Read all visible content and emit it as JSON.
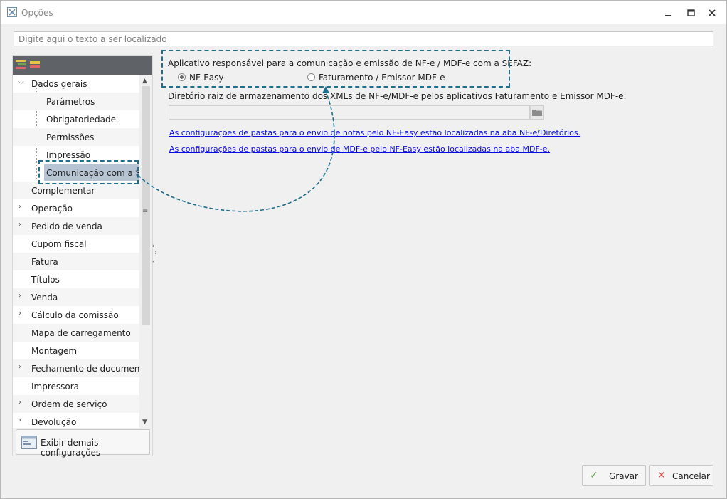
{
  "window": {
    "title": "Opções"
  },
  "search": {
    "placeholder": "Digite aqui o texto a ser localizado",
    "value": ""
  },
  "tree": {
    "items": [
      {
        "label": "Dados gerais",
        "level": 1,
        "expanded": true
      },
      {
        "label": "Parâmetros",
        "level": 2
      },
      {
        "label": "Obrigatoriedade",
        "level": 2
      },
      {
        "label": "Permissões",
        "level": 2
      },
      {
        "label": "Impressão",
        "level": 2
      },
      {
        "label": "Comunicação com a SEF",
        "level": 2,
        "selected": true
      },
      {
        "label": "Complementar",
        "level": 1
      },
      {
        "label": "Operação",
        "level": 1,
        "collapsed": true
      },
      {
        "label": "Pedido de venda",
        "level": 1,
        "collapsed": true
      },
      {
        "label": "Cupom fiscal",
        "level": 1
      },
      {
        "label": "Fatura",
        "level": 1
      },
      {
        "label": "Títulos",
        "level": 1
      },
      {
        "label": "Venda",
        "level": 1,
        "collapsed": true
      },
      {
        "label": "Cálculo da comissão",
        "level": 1,
        "collapsed": true
      },
      {
        "label": "Mapa de carregamento",
        "level": 1
      },
      {
        "label": "Montagem",
        "level": 1
      },
      {
        "label": "Fechamento de documentos",
        "level": 1,
        "collapsed": true
      },
      {
        "label": "Impressora",
        "level": 1
      },
      {
        "label": "Ordem de serviço",
        "level": 1,
        "collapsed": true
      },
      {
        "label": "Devolução",
        "level": 1,
        "collapsed": true
      }
    ],
    "show_more_label": "Exibir demais configurações"
  },
  "main": {
    "group_label": "Aplicativo responsável para a comunicação e emissão de NF-e / MDF-e com a SEFAZ:",
    "radio_options": [
      {
        "label": "NF-Easy",
        "checked": true
      },
      {
        "label": "Faturamento / Emissor MDF-e",
        "checked": false
      }
    ],
    "dir_label": "Diretório raiz de armazenamento dos XMLs de NF-e/MDF-e pelos aplicativos Faturamento e Emissor MDF-e:",
    "dir_value": "",
    "link_nfe": "As configurações de pastas para o envio de notas pelo NF-Easy estão localizadas na aba NF-e/Diretórios.",
    "link_mdfe": "As configurações de pastas para o envio de MDF-e pelo NF-Easy estão localizadas na aba MDF-e."
  },
  "footer": {
    "save_label": "Gravar",
    "cancel_label": "Cancelar"
  },
  "colors": {
    "highlight": "#1f6e8c",
    "link": "#0a0ae0",
    "selected_row": "#b7c4d3",
    "save_icon": "#6aa84f",
    "cancel_icon": "#d9534f"
  },
  "icons": {
    "app": "app-logo-icon",
    "minimize": "minimize-icon",
    "restore": "restore-icon",
    "close": "close-icon",
    "folder": "folder-icon",
    "save": "check-icon",
    "cancel": "x-icon"
  }
}
